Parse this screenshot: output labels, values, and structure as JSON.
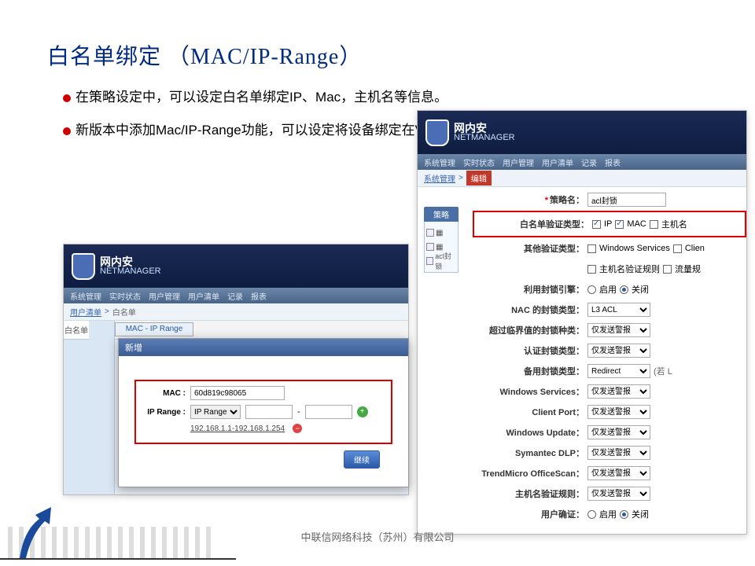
{
  "title": "白名单绑定 （MAC/IP-Range）",
  "bullets": {
    "b1": "在策略设定中，可以设定白名单绑定IP、Mac，主机名等信息。",
    "b2": "新版本中添加Mac/IP-Range功能，可以设定将设备绑定在VLAN段。"
  },
  "logo": {
    "cn": "网内安",
    "en": "NETMANAGER"
  },
  "menu": {
    "m1": "系统管理",
    "m2": "实时状态",
    "m3": "用户管理",
    "m4": "用户清单",
    "m5": "记录",
    "m6": "报表"
  },
  "left": {
    "crumb1": "用户清单",
    "crumb_sep": ">",
    "crumb2": "白名单",
    "tab1": "白名单",
    "tab2": "MAC - IP Range",
    "side_hdr": "MAC - IP R"
  },
  "dialog": {
    "title": "新增",
    "mac_lbl": "MAC :",
    "mac_val": "60d819c98065",
    "range_lbl": "IP Range :",
    "range_mode": "IP Range",
    "dash": "-",
    "range_val": "192.168.1.1-192.168.1.254",
    "btn": "继续"
  },
  "right": {
    "crumb1": "系统管理",
    "crumb_sep": ">",
    "crumb2": "编辑",
    "strip_hdr": "策略",
    "strip1": "",
    "strip2": "",
    "strip3": "acl封锁",
    "rows": {
      "policy_name": {
        "lbl": "策略名：",
        "val": "acl封锁"
      },
      "white_type": {
        "lbl": "白名单验证类型：",
        "o1": "IP",
        "o2": "MAC",
        "o3": "主机名"
      },
      "other_type": {
        "lbl": "其他验证类型：",
        "o1": "Windows Services",
        "o2": "Clien",
        "o3": "主机名验证规则",
        "o4": "流量规"
      },
      "block_ref": {
        "lbl": "利用封锁引擎：",
        "o1": "启用",
        "o2": "关闭"
      },
      "nac_type": {
        "lbl": "NAC 的封锁类型：",
        "val": "L3 ACL"
      },
      "over_thresh": {
        "lbl": "超过临界值的封锁种类：",
        "val": "仅发送警报"
      },
      "auth_block": {
        "lbl": "认证封锁类型：",
        "val": "仅发送警报"
      },
      "backup_block": {
        "lbl": "备用封锁类型：",
        "val": "Redirect",
        "suffix": "(若 L"
      },
      "win_svc": {
        "lbl": "Windows Services：",
        "val": "仅发送警报"
      },
      "client_port": {
        "lbl": "Client Port：",
        "val": "仅发送警报"
      },
      "win_upd": {
        "lbl": "Windows Update：",
        "val": "仅发送警报"
      },
      "sym_dlp": {
        "lbl": "Symantec DLP：",
        "val": "仅发送警报"
      },
      "trend": {
        "lbl": "TrendMicro OfficeScan：",
        "val": "仅发送警报"
      },
      "host_rule": {
        "lbl": "主机名验证规则：",
        "val": "仅发送警报"
      },
      "user_confirm": {
        "lbl": "用户确证：",
        "o1": "启用",
        "o2": "关闭"
      }
    }
  },
  "company": "中联信网络科技（苏州）有限公司"
}
